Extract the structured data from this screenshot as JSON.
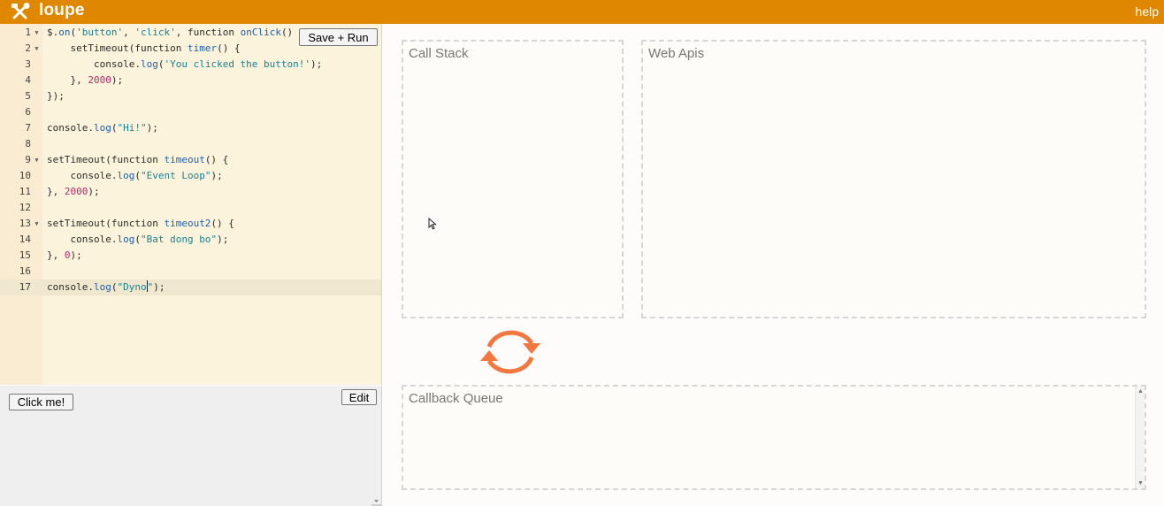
{
  "header": {
    "logo_icon": "hammer-wrench-icon",
    "title": "loupe",
    "help": "help",
    "bg_color": "#e08700"
  },
  "editor": {
    "save_run_label": "Save + Run",
    "active_line": 17,
    "lines": [
      {
        "n": "1",
        "fold": true,
        "text": "$.on('button', 'click', function onClick() {"
      },
      {
        "n": "2",
        "fold": true,
        "text": "    setTimeout(function timer() {"
      },
      {
        "n": "3",
        "fold": false,
        "text": "        console.log('You clicked the button!');"
      },
      {
        "n": "4",
        "fold": false,
        "text": "    }, 2000);"
      },
      {
        "n": "5",
        "fold": false,
        "text": "});"
      },
      {
        "n": "6",
        "fold": false,
        "text": ""
      },
      {
        "n": "7",
        "fold": false,
        "text": "console.log(\"Hi!\");"
      },
      {
        "n": "8",
        "fold": false,
        "text": ""
      },
      {
        "n": "9",
        "fold": true,
        "text": "setTimeout(function timeout() {"
      },
      {
        "n": "10",
        "fold": false,
        "text": "    console.log(\"Event Loop\");"
      },
      {
        "n": "11",
        "fold": false,
        "text": "}, 2000);"
      },
      {
        "n": "12",
        "fold": false,
        "text": ""
      },
      {
        "n": "13",
        "fold": true,
        "text": "setTimeout(function timeout2() {"
      },
      {
        "n": "14",
        "fold": false,
        "text": "    console.log(\"Bat dong bo\");"
      },
      {
        "n": "15",
        "fold": false,
        "text": "}, 0);"
      },
      {
        "n": "16",
        "fold": false,
        "text": ""
      },
      {
        "n": "17",
        "fold": false,
        "text": "console.log(\"Dyno\");"
      }
    ]
  },
  "preview": {
    "click_me_label": "Click me!",
    "edit_label": "Edit"
  },
  "panels": {
    "call_stack": "Call Stack",
    "web_apis": "Web Apis",
    "callback_queue": "Callback Queue"
  },
  "event_loop_icon": "refresh-cycle-icon",
  "loop_color": "#f2783f"
}
